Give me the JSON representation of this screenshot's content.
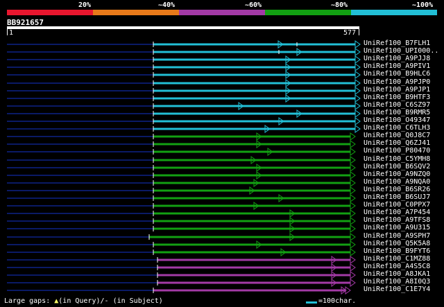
{
  "header": {
    "percent_labels": [
      "20%",
      "~40%",
      "~60%",
      "~80%",
      "~100%"
    ],
    "colors": [
      "#e8162e",
      "#e87a1a",
      "#a33aa6",
      "#12a012",
      "#22bfd6"
    ]
  },
  "query": {
    "id": "BB921657",
    "start": "1",
    "end": "577"
  },
  "hits": [
    {
      "label": "UniRef100_B7FLH1",
      "color": "#22bfd6"
    },
    {
      "label": "UniRef100_UPI000..",
      "color": "#22bfd6"
    },
    {
      "label": "UniRef100_A9PJJ8",
      "color": "#22bfd6"
    },
    {
      "label": "UniRef100_A9PIV1",
      "color": "#22bfd6"
    },
    {
      "label": "UniRef100_B9HLC6",
      "color": "#22bfd6"
    },
    {
      "label": "UniRef100_A9PJP0",
      "color": "#22bfd6"
    },
    {
      "label": "UniRef100_A9PJP1",
      "color": "#22bfd6"
    },
    {
      "label": "UniRef100_B9HTF3",
      "color": "#22bfd6"
    },
    {
      "label": "UniRef100_C6SZ97",
      "color": "#22bfd6"
    },
    {
      "label": "UniRef100_B9RMR5",
      "color": "#22bfd6"
    },
    {
      "label": "UniRef100_O49347",
      "color": "#22bfd6"
    },
    {
      "label": "UniRef100_C6TLH3",
      "color": "#22bfd6"
    },
    {
      "label": "UniRef100_Q0J8C7",
      "color": "#12a012"
    },
    {
      "label": "UniRef100_Q6ZJ41",
      "color": "#12a012"
    },
    {
      "label": "UniRef100_P80470",
      "color": "#12a012"
    },
    {
      "label": "UniRef100_C5YMH8",
      "color": "#12a012"
    },
    {
      "label": "UniRef100_B6SQV2",
      "color": "#12a012"
    },
    {
      "label": "UniRef100_A9NZQ0",
      "color": "#12a012"
    },
    {
      "label": "UniRef100_A9NQA0",
      "color": "#12a012"
    },
    {
      "label": "UniRef100_B6SR26",
      "color": "#12a012"
    },
    {
      "label": "UniRef100_B6SUJ7",
      "color": "#12a012"
    },
    {
      "label": "UniRef100_C0PPX7",
      "color": "#12a012"
    },
    {
      "label": "UniRef100_A7P454",
      "color": "#12a012"
    },
    {
      "label": "UniRef100_A9TFS8",
      "color": "#12a012"
    },
    {
      "label": "UniRef100_A9U315",
      "color": "#12a012"
    },
    {
      "label": "UniRef100_A9SPH7",
      "color": "#12a012"
    },
    {
      "label": "UniRef100_Q5K5A8",
      "color": "#12a012"
    },
    {
      "label": "UniRef100_B9FYT6",
      "color": "#12a012"
    },
    {
      "label": "UniRef100_C1MZ88",
      "color": "#a33aa6"
    },
    {
      "label": "UniRef100_A4S5C8",
      "color": "#a33aa6"
    },
    {
      "label": "UniRef100_A8JKA1",
      "color": "#a33aa6"
    },
    {
      "label": "UniRef100_A8I0Q3",
      "color": "#a33aa6"
    },
    {
      "label": "UniRef100_C1E7Y4",
      "color": "#a33aa6"
    }
  ],
  "footer": {
    "gap_prefix": "Large gaps: ",
    "gap_query": "(in Query)/",
    "gap_dash": "-",
    "gap_subject": " (in Subject)",
    "legend": "=100char."
  }
}
